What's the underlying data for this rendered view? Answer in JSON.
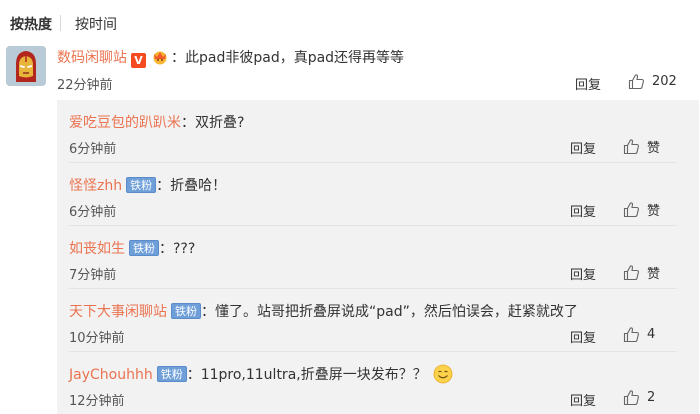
{
  "sort": {
    "hot": "按热度",
    "time": "按时间"
  },
  "main_comment": {
    "username": "数码闲聊站",
    "vip_badge": "V",
    "text": "：此pad非彼pad，真pad还得再等等",
    "time": "22分钟前",
    "reply_label": "回复",
    "like_count": "202",
    "avatar_icon": "iron-man-avatar-icon"
  },
  "replies": [
    {
      "username": "爱吃豆包的趴趴米",
      "badge": "",
      "text": "：双折叠?",
      "time": "6分钟前",
      "reply_label": "回复",
      "like": "赞"
    },
    {
      "username": "怪怪zhh",
      "badge": "铁粉",
      "text": "：折叠哈！",
      "time": "6分钟前",
      "reply_label": "回复",
      "like": "赞"
    },
    {
      "username": "如丧如生",
      "badge": "铁粉",
      "text": "：???",
      "time": "7分钟前",
      "reply_label": "回复",
      "like": "赞"
    },
    {
      "username": "天下大事闲聊站",
      "badge": "铁粉",
      "text": "：懂了。站哥把折叠屏说成“pad”，然后怕误会，赶紧就改了",
      "time": "10分钟前",
      "reply_label": "回复",
      "like": "4"
    },
    {
      "username": "JayChouhhh",
      "badge": "铁粉",
      "text": "：11pro,11ultra,折叠屏一块发布？？",
      "time": "12分钟前",
      "reply_label": "回复",
      "like": "2"
    }
  ],
  "colors": {
    "username": "#eb7350",
    "badge_blue": "#6f9fd8",
    "vip_red": "#f44b20",
    "reply_bg": "#f2f2f2"
  }
}
